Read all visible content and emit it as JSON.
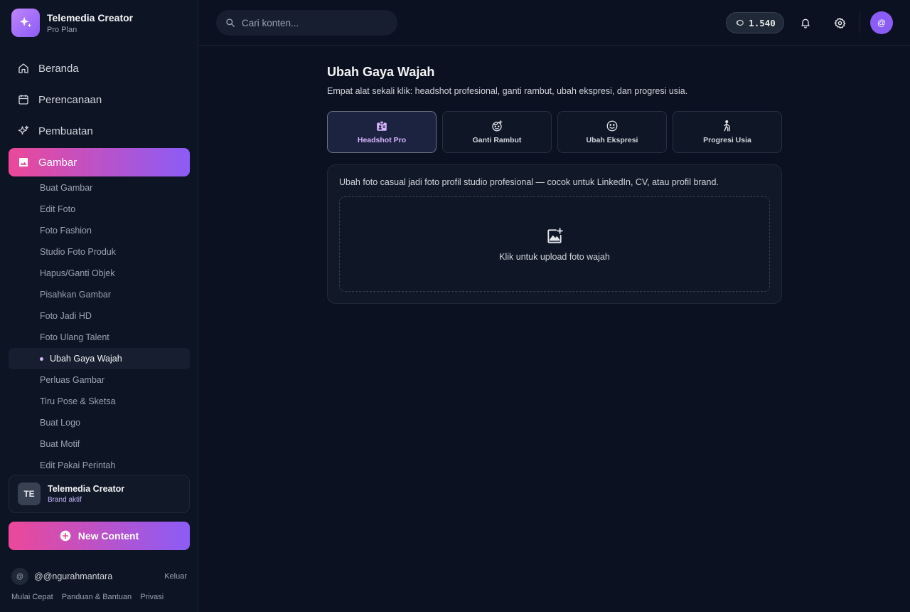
{
  "brand": {
    "name": "Telemedia Creator",
    "plan": "Pro Plan"
  },
  "nav": [
    {
      "label": "Beranda",
      "icon": "home-icon"
    },
    {
      "label": "Perencanaan",
      "icon": "calendar-icon"
    },
    {
      "label": "Pembuatan",
      "icon": "sparkle-icon"
    },
    {
      "label": "Gambar",
      "icon": "image-icon",
      "active": true
    }
  ],
  "submenu": [
    "Buat Gambar",
    "Edit Foto",
    "Foto Fashion",
    "Studio Foto Produk",
    "Hapus/Ganti Objek",
    "Pisahkan Gambar",
    "Foto Jadi HD",
    "Foto Ulang Talent",
    "Ubah Gaya Wajah",
    "Perluas Gambar",
    "Tiru Pose & Sketsa",
    "Buat Logo",
    "Buat Motif",
    "Edit Pakai Perintah"
  ],
  "submenu_active_index": 8,
  "brand_card": {
    "initials": "TE",
    "name": "Telemedia Creator",
    "status": "Brand aktif"
  },
  "new_content_label": "New Content",
  "user": {
    "avatar": "@",
    "handle": "@@ngurahmantara",
    "logout": "Keluar"
  },
  "footer_links": [
    "Mulai Cepat",
    "Panduan & Bantuan",
    "Privasi"
  ],
  "topbar": {
    "search_placeholder": "Cari konten...",
    "credits": "1.540",
    "avatar": "@"
  },
  "page": {
    "title": "Ubah Gaya Wajah",
    "description": "Empat alat sekali klik: headshot profesional, ganti rambut, ubah ekspresi, dan progresi usia."
  },
  "tools": [
    {
      "label": "Headshot Pro",
      "icon": "id-badge-icon",
      "active": true
    },
    {
      "label": "Ganti Rambut",
      "icon": "face-hair-icon"
    },
    {
      "label": "Ubah Ekspresi",
      "icon": "smile-icon"
    },
    {
      "label": "Progresi Usia",
      "icon": "elderly-walk-icon"
    }
  ],
  "panel": {
    "description": "Ubah foto casual jadi foto profil studio profesional — cocok untuk LinkedIn, CV, atau profil brand.",
    "upload_label": "Klik untuk upload foto wajah"
  },
  "colors": {
    "accent_start": "#ec4899",
    "accent_end": "#8b5cf6",
    "background": "#0b1120",
    "highlight": "#d8b4fe"
  }
}
